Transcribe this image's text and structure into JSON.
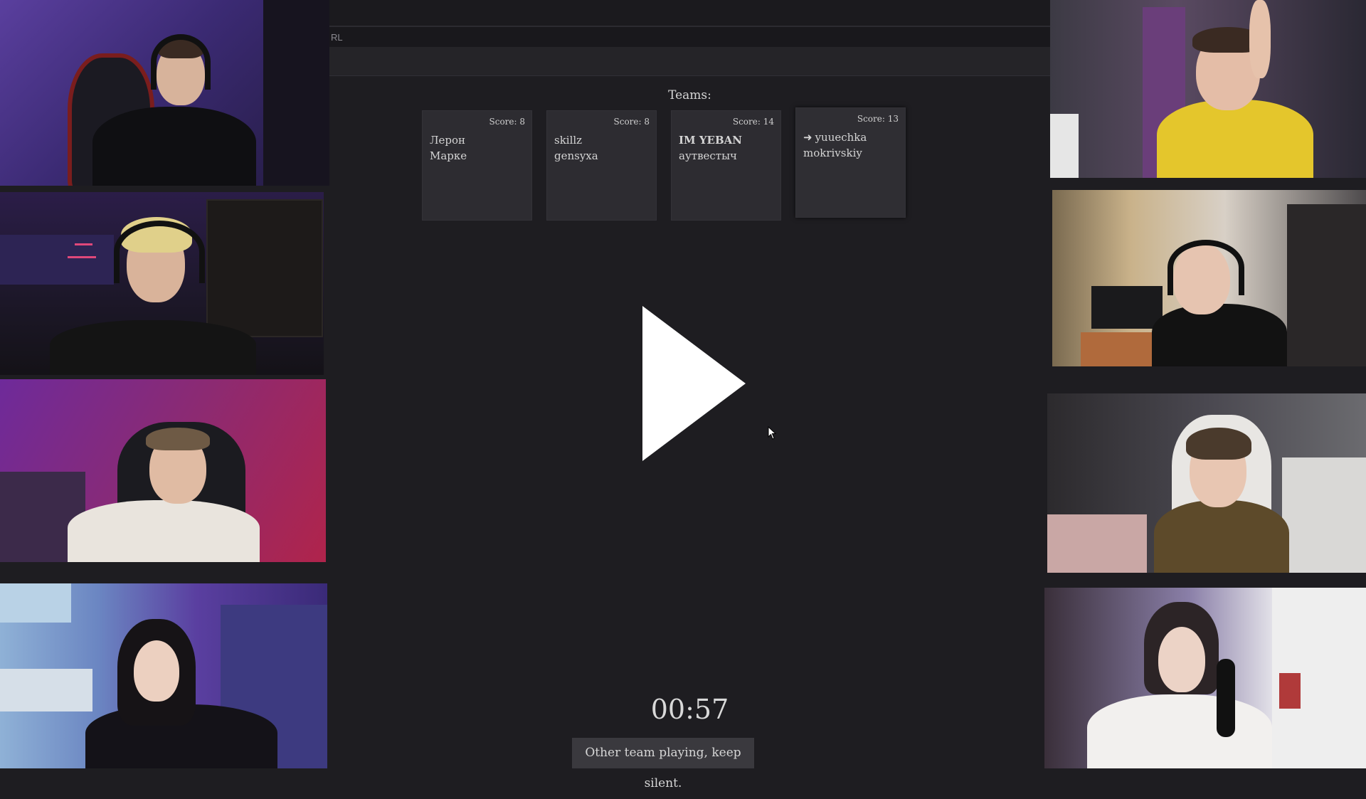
{
  "browser": {
    "url_fragment": "RL"
  },
  "teams": {
    "heading": "Teams:",
    "cards": [
      {
        "score": "Score: 8",
        "members": [
          "Лерон",
          "Марке"
        ],
        "bold": false,
        "current": false
      },
      {
        "score": "Score: 8",
        "members": [
          "skillz",
          "gensyxa"
        ],
        "bold": false,
        "current": false
      },
      {
        "score": "Score: 14",
        "members": [
          "IM YEBAN",
          "аутвестыч"
        ],
        "bold": true,
        "current": false
      },
      {
        "score": "Score: 13",
        "members": [
          "yuuechka",
          "mokrivskiy"
        ],
        "bold": false,
        "current": true,
        "marker": "➜"
      }
    ]
  },
  "player": {
    "icon": "play-icon"
  },
  "timer": "00:57",
  "status": "Other team playing, keep silent.",
  "colors": {
    "background": "#1e1d21",
    "card": "#2d2c31",
    "status_bg": "#3a393e"
  }
}
